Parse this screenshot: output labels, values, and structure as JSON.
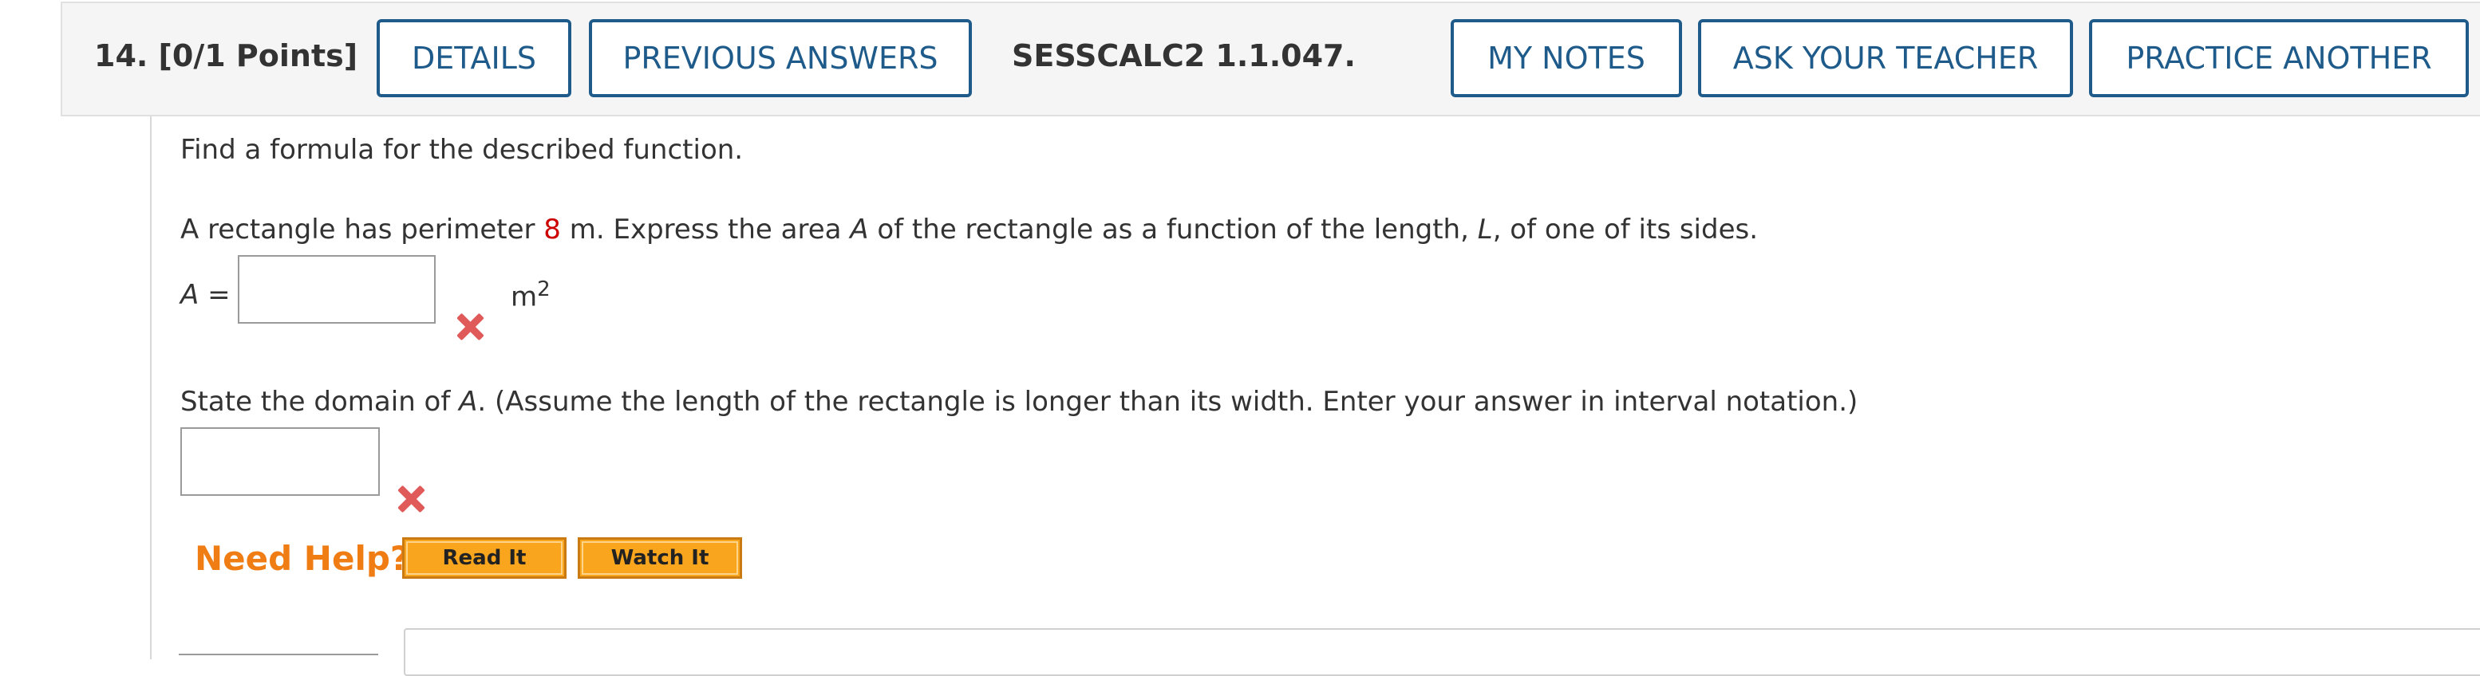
{
  "header": {
    "question_label": "14.  [0/1 Points]",
    "details_label": "DETAILS",
    "previous_answers_label": "PREVIOUS ANSWERS",
    "assignment_code": "SESSCALC2 1.1.047.",
    "my_notes_label": "MY NOTES",
    "ask_teacher_label": "ASK YOUR TEACHER",
    "practice_another_label": "PRACTICE ANOTHER"
  },
  "question": {
    "instruction": "Find a formula for the described function.",
    "problem_pre": "A rectangle has perimeter ",
    "perimeter_value": "8",
    "problem_mid1": " m. Express the area ",
    "var_area": "A",
    "problem_mid2": " of the rectangle as a function of the length, ",
    "var_length": "L",
    "problem_post": ", of one of its sides.",
    "answer1_label": "A =",
    "answer1_value": "",
    "answer1_unit_base": "m",
    "answer1_unit_exp": "2",
    "answer1_status": "incorrect",
    "domain_pre": "State the domain of ",
    "domain_var": "A",
    "domain_post": ". (Assume the length of the rectangle is longer than its width. Enter your answer in interval notation.)",
    "answer2_value": "",
    "answer2_status": "incorrect"
  },
  "help": {
    "label": "Need Help?",
    "read_it": "Read It",
    "watch_it": "Watch It"
  },
  "colors": {
    "accent_blue": "#1e5b8a",
    "incorrect_red": "#e05a5a",
    "help_orange": "#f07c14",
    "button_orange": "#f9a51e",
    "highlight_red": "#cc0000"
  }
}
